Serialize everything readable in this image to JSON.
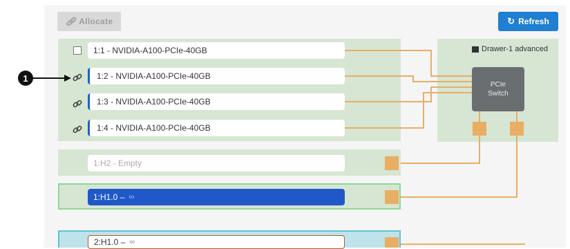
{
  "toolbar": {
    "allocate_label": "Allocate",
    "refresh_label": "Refresh"
  },
  "drawer": {
    "label": "Drawer-1 advanced",
    "switch_line1": "PCIe",
    "switch_line2": "Switch"
  },
  "gpus": [
    {
      "label": "1:1 - NVIDIA-A100-PCIe-40GB",
      "control": "checkbox"
    },
    {
      "label": "1:2 - NVIDIA-A100-PCIe-40GB",
      "control": "link"
    },
    {
      "label": "1:3 - NVIDIA-A100-PCIe-40GB",
      "control": "link"
    },
    {
      "label": "1:4 - NVIDIA-A100-PCIe-40GB",
      "control": "link"
    }
  ],
  "hosts": [
    {
      "label": "1:H2 - Empty",
      "state": "empty"
    },
    {
      "label": "1:H1.0 –",
      "state": "selected"
    },
    {
      "label": "2:H1.0 –",
      "state": "outlined"
    }
  ],
  "callout": {
    "number": "1"
  },
  "colors": {
    "accent": "#1f7fd0",
    "group_bg": "#d6e6d3",
    "wire": "#e8ae63",
    "switch": "#6b6e71",
    "host_selected": "#2158c9"
  }
}
